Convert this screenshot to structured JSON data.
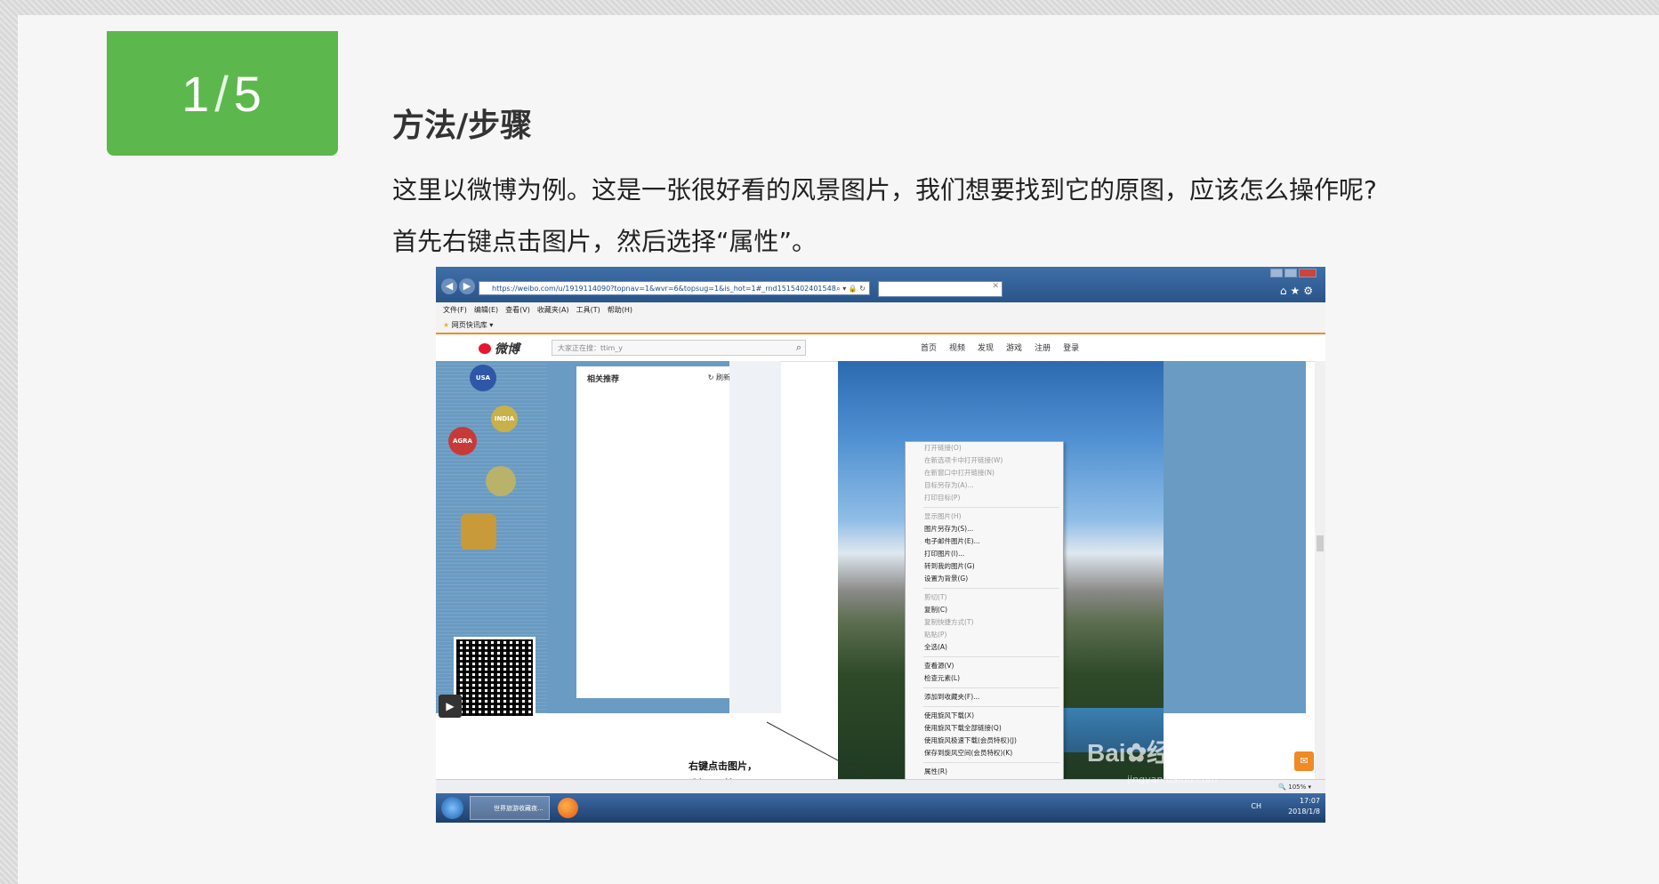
{
  "step": {
    "current": "1",
    "separator": "/",
    "total": "5"
  },
  "title": "方法/步骤",
  "paragraph1": "这里以微博为例。这是一张很好看的风景图片，我们想要找到它的原图，应该怎么操作呢?",
  "paragraph2": "首先右键点击图片，然后选择“属性”。",
  "browser": {
    "url": "https://weibo.com/u/1919114090?topnav=1&wvr=6&topsug=1&is_hot=1#_rnd1515402401548",
    "menu": [
      "文件(F)",
      "编辑(E)",
      "查看(V)",
      "收藏夹(A)",
      "工具(T)",
      "帮助(H)"
    ],
    "fav": "网页快讯库 ▾",
    "zoom": "105%"
  },
  "weibo": {
    "logo": "微博",
    "search_placeholder": "大家正在搜：ttim_y",
    "nav": [
      "首页",
      "视频",
      "发现",
      "游戏",
      "注册",
      "登录"
    ],
    "panel_title": "相关推荐",
    "panel_refresh": "刷新",
    "stickers": [
      "USA",
      "INDIA",
      "AGRA"
    ]
  },
  "context_menu": [
    {
      "label": "打开链接(O)",
      "dim": true
    },
    {
      "label": "在新选项卡中打开链接(W)",
      "dim": true
    },
    {
      "label": "在新窗口中打开链接(N)",
      "dim": true
    },
    {
      "label": "目标另存为(A)...",
      "dim": true
    },
    {
      "label": "打印目标(P)",
      "dim": true
    },
    {
      "sep": true
    },
    {
      "label": "显示图片(H)",
      "dim": true
    },
    {
      "label": "图片另存为(S)...",
      "dim": false
    },
    {
      "label": "电子邮件图片(E)...",
      "dim": false
    },
    {
      "label": "打印图片(I)...",
      "dim": false
    },
    {
      "label": "转到我的图片(G)",
      "dim": false
    },
    {
      "label": "设置为背景(G)",
      "dim": false
    },
    {
      "sep": true
    },
    {
      "label": "剪切(T)",
      "dim": true
    },
    {
      "label": "复制(C)",
      "dim": false
    },
    {
      "label": "复制快捷方式(T)",
      "dim": true
    },
    {
      "label": "粘贴(P)",
      "dim": true
    },
    {
      "label": "全选(A)",
      "dim": false
    },
    {
      "sep": true
    },
    {
      "label": "查看源(V)",
      "dim": false
    },
    {
      "label": "检查元素(L)",
      "dim": false
    },
    {
      "sep": true
    },
    {
      "label": "添加到收藏夹(F)...",
      "dim": false
    },
    {
      "sep": true
    },
    {
      "label": "使用旋风下载(X)",
      "dim": false
    },
    {
      "label": "使用旋风下载全部链接(Q)",
      "dim": false
    },
    {
      "label": "使用旋风极速下载(会员特权)(J)",
      "dim": false
    },
    {
      "label": "保存到旋风空间(会员特权)(K)",
      "dim": false
    },
    {
      "sep": true
    },
    {
      "label": "属性(R)",
      "dim": false
    }
  ],
  "callout": {
    "line1": "右键点击图片，",
    "line2": "选择“属性”"
  },
  "watermark": {
    "brand": "Bai",
    "brand2": "经验",
    "url": "jingyan.baidu.com"
  },
  "taskbar": {
    "window": "世界旅游收藏夜...",
    "lang": "CH",
    "time": "17:07",
    "date": "2018/1/8"
  },
  "colors": {
    "badge": "#5cb84c",
    "weibo_red": "#e6162d",
    "accent": "#f08a24"
  }
}
